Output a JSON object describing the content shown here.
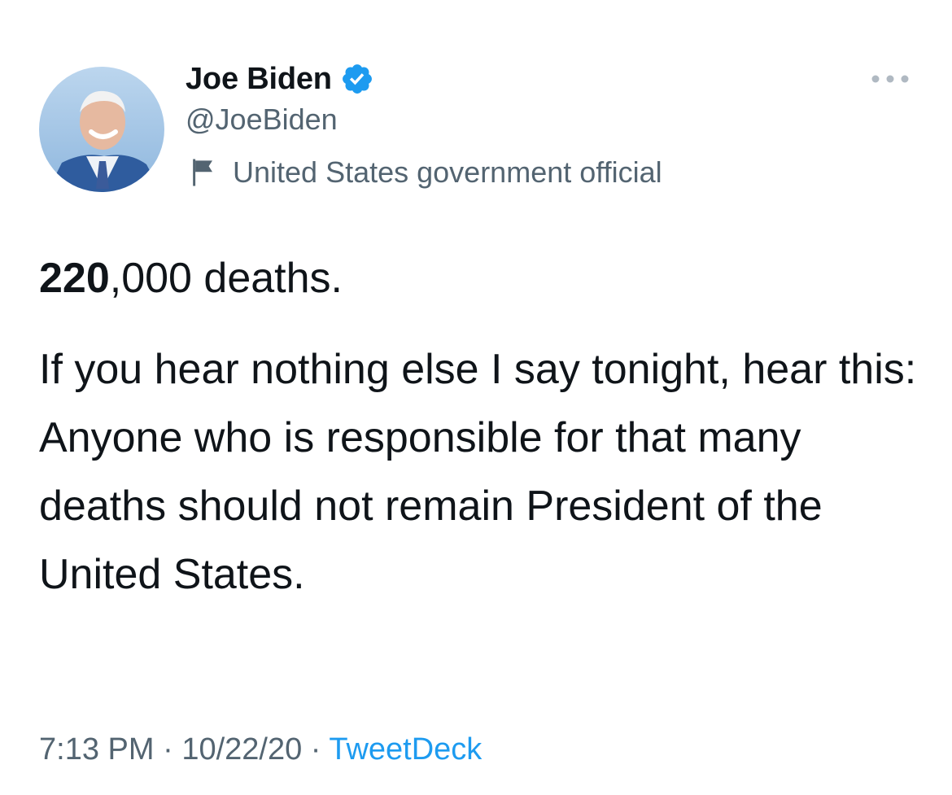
{
  "author": {
    "display_name": "Joe Biden",
    "handle": "@JoeBiden",
    "label": "United States government official",
    "verified_icon": "verified-badge-icon",
    "label_icon": "flag-icon"
  },
  "tweet": {
    "lead_bold": "220",
    "lead_rest": ",000 deaths.",
    "body": "If you hear nothing else I say tonight, hear this: Anyone who is responsible for that many deaths should not remain President of the United States."
  },
  "meta": {
    "time": "7:13 PM",
    "separator": "·",
    "date": "10/22/20",
    "source": "TweetDeck"
  },
  "colors": {
    "accent": "#1d9bf0",
    "text": "#0f1419",
    "secondary": "#536471"
  }
}
